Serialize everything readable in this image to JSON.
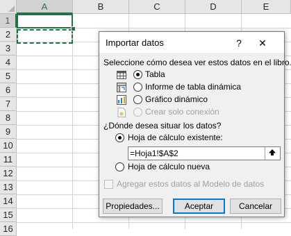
{
  "sheet": {
    "columns": [
      "A",
      "B",
      "C",
      "D",
      "E"
    ],
    "rows": [
      "1",
      "2",
      "3",
      "4",
      "5",
      "6",
      "7",
      "8",
      "9",
      "10",
      "11",
      "12",
      "13",
      "14",
      "15",
      "16"
    ],
    "selected_column": "A",
    "selected_row": "1",
    "accent": "#217346"
  },
  "dialog": {
    "title": "Importar datos",
    "help_label": "?",
    "close_label": "✕",
    "view_prompt": "Seleccione cómo desea ver estos datos en el libro.",
    "view_options": [
      {
        "label": "Tabla",
        "selected": true,
        "enabled": true,
        "icon": "table-icon"
      },
      {
        "label": "Informe de tabla dinámica",
        "selected": false,
        "enabled": true,
        "icon": "pivot-table-icon"
      },
      {
        "label": "Gráfico dinámico",
        "selected": false,
        "enabled": true,
        "icon": "pivot-chart-icon"
      },
      {
        "label": "Crear solo conexión",
        "selected": false,
        "enabled": false,
        "icon": "connection-only-icon"
      }
    ],
    "location_prompt": "¿Dónde desea situar los datos?",
    "location_options": [
      {
        "label": "Hoja de cálculo existente:",
        "selected": true
      },
      {
        "label": "Hoja de cálculo nueva",
        "selected": false
      }
    ],
    "reference_value": "=Hoja1!$A$2",
    "data_model_label": "Agregar estos datos al Modelo de datos",
    "data_model_checked": false,
    "buttons": {
      "properties": "Propiedades...",
      "accept": "Aceptar",
      "cancel": "Cancelar"
    }
  }
}
